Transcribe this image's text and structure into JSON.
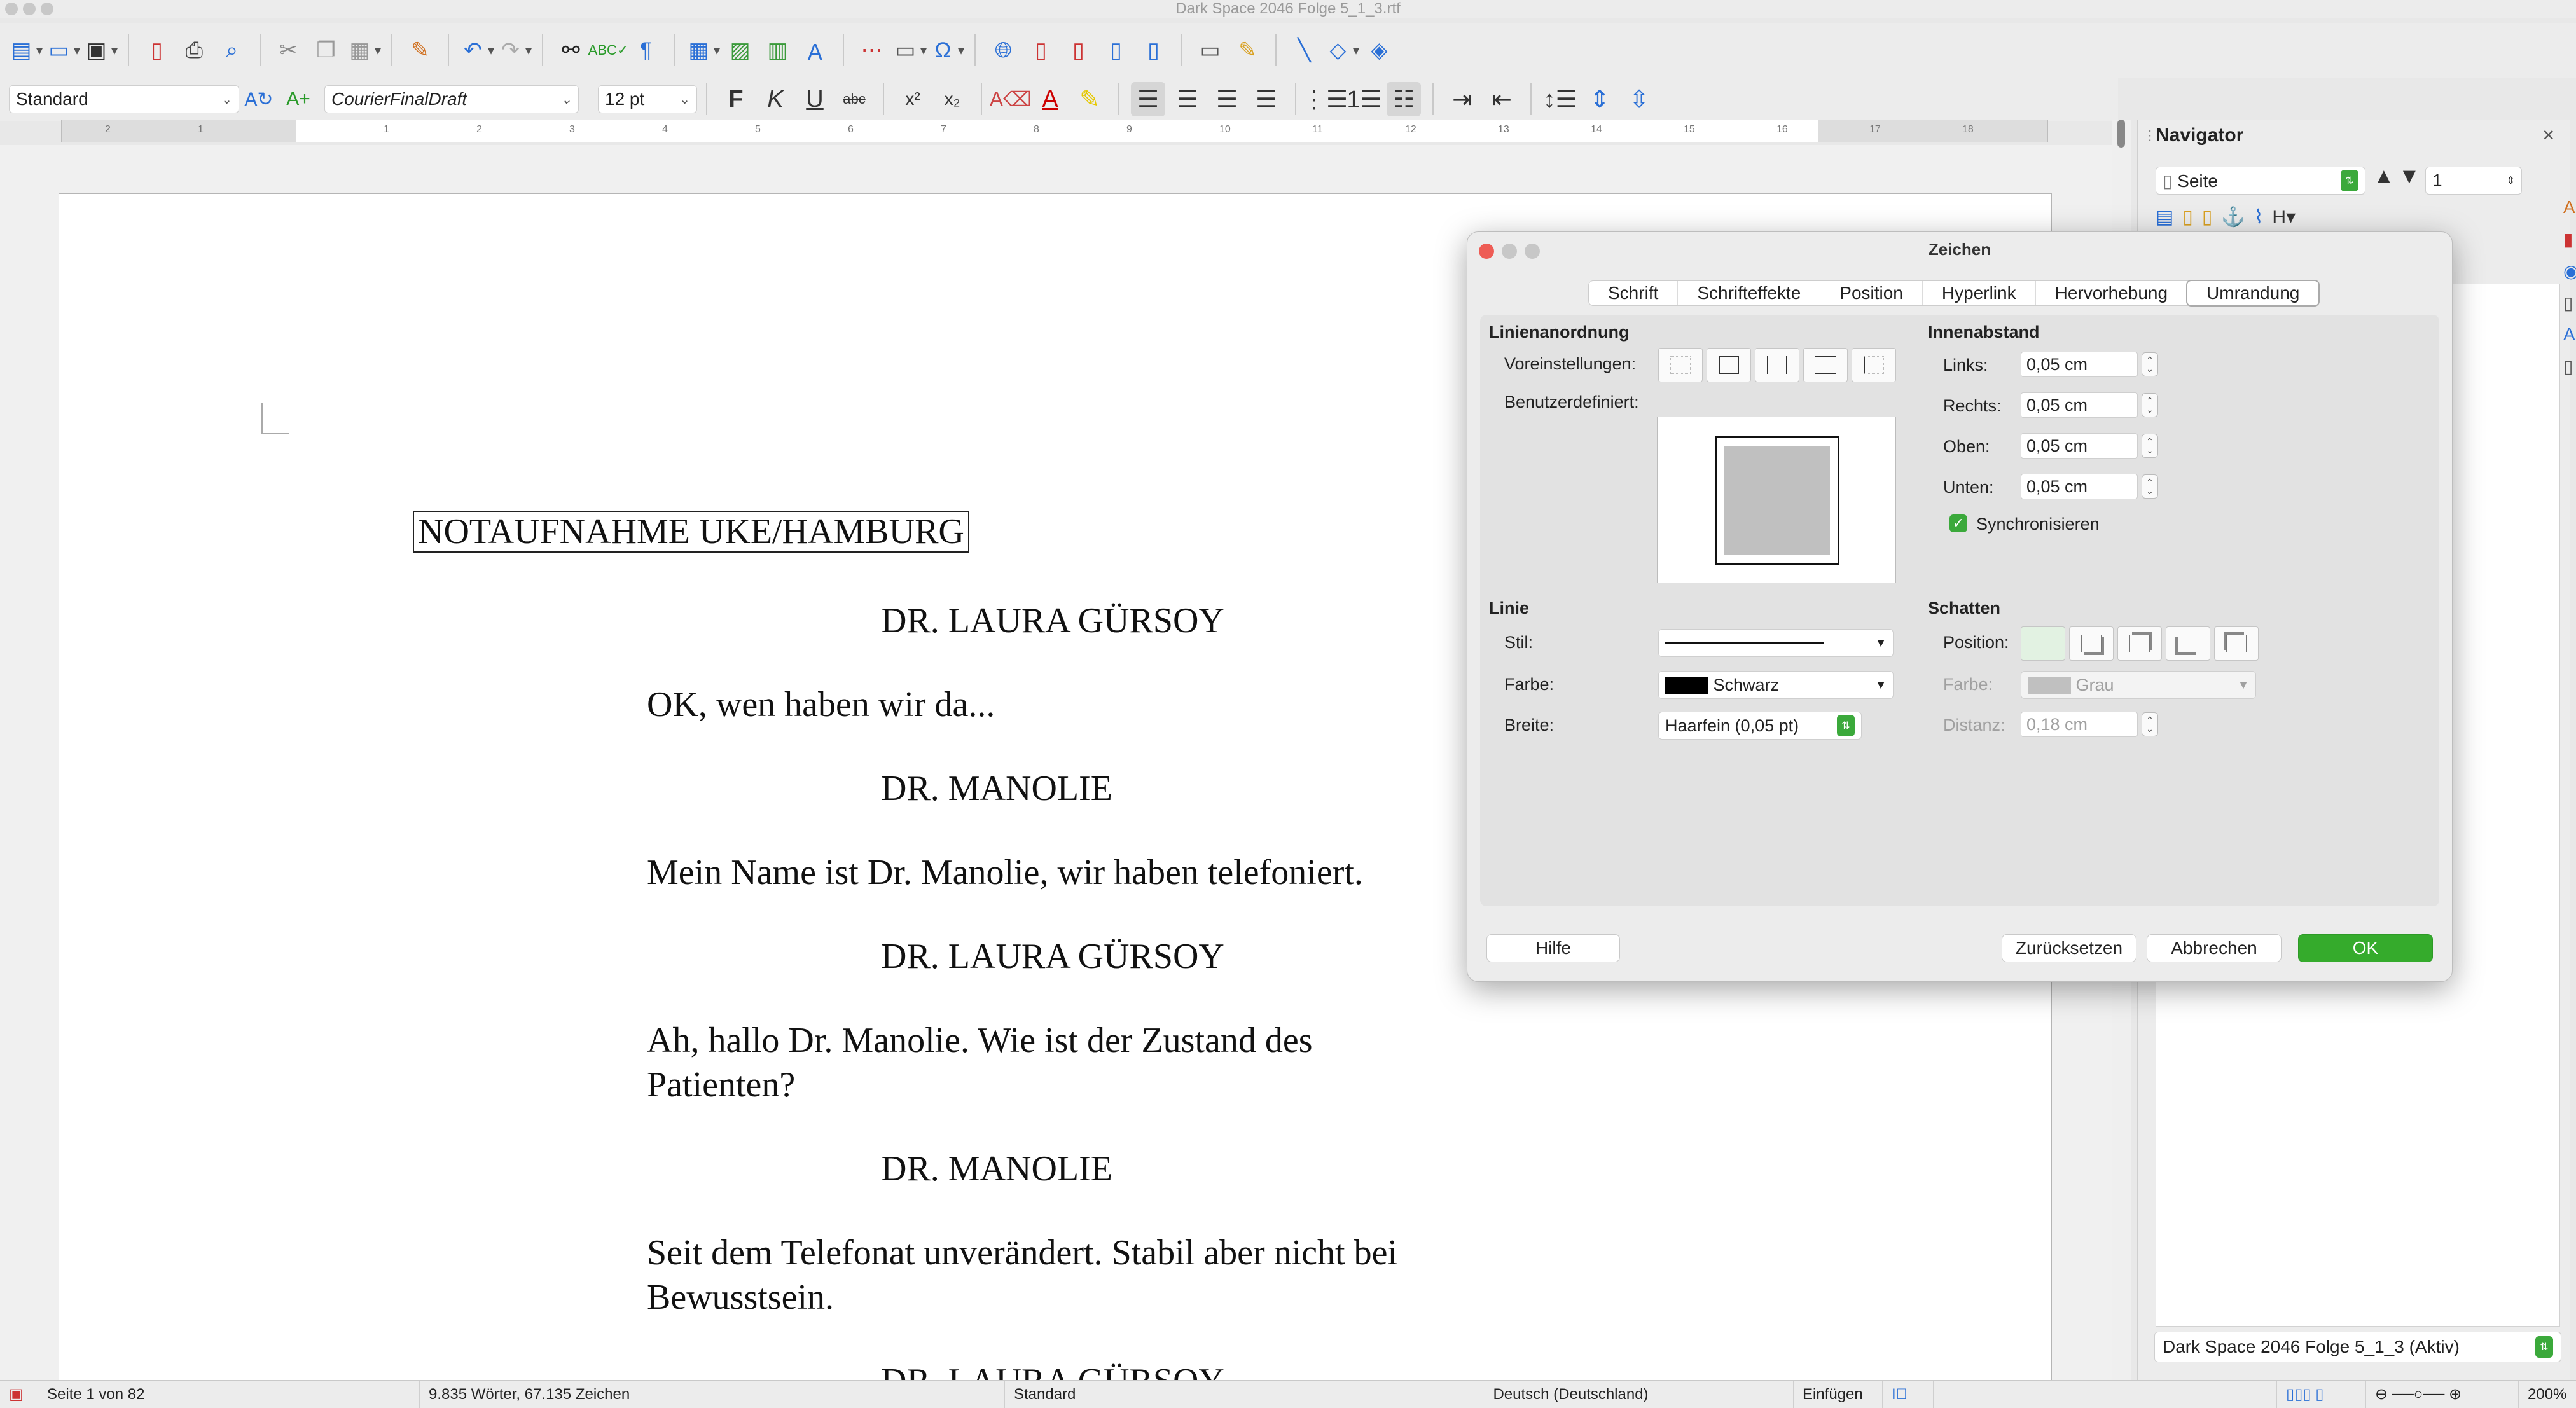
{
  "window": {
    "title": "Dark Space 2046 Folge 5_1_3.rtf"
  },
  "toolbar2": {
    "paragraph_style": "Standard",
    "font_name": "CourierFinalDraft",
    "font_size": "12 pt"
  },
  "ruler": {
    "ticks": [
      "2",
      "1",
      "1",
      "2",
      "3",
      "4",
      "5",
      "6",
      "7",
      "8",
      "9",
      "10",
      "11",
      "12",
      "13",
      "14",
      "15",
      "16",
      "17",
      "18"
    ]
  },
  "document": {
    "paragraphs": [
      {
        "text": "NOTAUFNAHME UKE/HAMBURG",
        "kind": "scene"
      },
      {
        "text": "DR. LAURA GÜRSOY",
        "kind": "character"
      },
      {
        "text": "OK, wen haben wir da...",
        "kind": "dialogue"
      },
      {
        "text": "DR. MANOLIE",
        "kind": "character"
      },
      {
        "text": "Mein Name ist Dr. Manolie, wir haben telefoniert.",
        "kind": "dialogue"
      },
      {
        "text": "DR. LAURA GÜRSOY",
        "kind": "character"
      },
      {
        "text": "Ah, hallo Dr. Manolie. Wie ist der Zustand des Patienten?",
        "kind": "dialogue"
      },
      {
        "text": "DR. MANOLIE",
        "kind": "character"
      },
      {
        "text": "Seit dem Telefonat unverändert. Stabil aber nicht bei Bewusstsein.",
        "kind": "dialogue"
      },
      {
        "text": "DR. LAURA GÜRSOY",
        "kind": "character"
      }
    ]
  },
  "navigator": {
    "title": "Navigator",
    "close": "×",
    "category": "Seite",
    "page_number": "1",
    "heading_button": "H",
    "document_select": "Dark Space 2046 Folge 5_1_3 (Aktiv)"
  },
  "dialog": {
    "title": "Zeichen",
    "tabs": [
      "Schrift",
      "Schrifteffekte",
      "Position",
      "Hyperlink",
      "Hervorhebung",
      "Umrandung"
    ],
    "active_tab": "Umrandung",
    "line_arrangement": {
      "heading": "Linienanordnung",
      "presets_label": "Voreinstellungen:",
      "custom_label": "Benutzerdefiniert:"
    },
    "padding": {
      "heading": "Innenabstand",
      "left_label": "Links:",
      "left_value": "0,05 cm",
      "right_label": "Rechts:",
      "right_value": "0,05 cm",
      "top_label": "Oben:",
      "top_value": "0,05 cm",
      "bottom_label": "Unten:",
      "bottom_value": "0,05 cm",
      "sync_label": "Synchronisieren",
      "sync_checked": true
    },
    "line": {
      "heading": "Linie",
      "style_label": "Stil:",
      "color_label": "Farbe:",
      "color_value": "Schwarz",
      "color_swatch": "#000000",
      "width_label": "Breite:",
      "width_value": "Haarfein (0,05 pt)"
    },
    "shadow": {
      "heading": "Schatten",
      "position_label": "Position:",
      "color_label": "Farbe:",
      "color_value": "Grau",
      "color_swatch": "#c0c0c0",
      "distance_label": "Distanz:",
      "distance_value": "0,18 cm"
    },
    "buttons": {
      "help": "Hilfe",
      "reset": "Zurücksetzen",
      "cancel": "Abbrechen",
      "ok": "OK"
    }
  },
  "statusbar": {
    "page": "Seite 1 von 82",
    "words": "9.835 Wörter, 67.135 Zeichen",
    "page_style": "Standard",
    "language": "Deutsch (Deutschland)",
    "insert_mode": "Einfügen",
    "zoom": "200%"
  },
  "colors": {
    "accent_green": "#35ab2c",
    "toolbar_blue": "#2a6fd6",
    "dialog_bg": "#ececec"
  }
}
